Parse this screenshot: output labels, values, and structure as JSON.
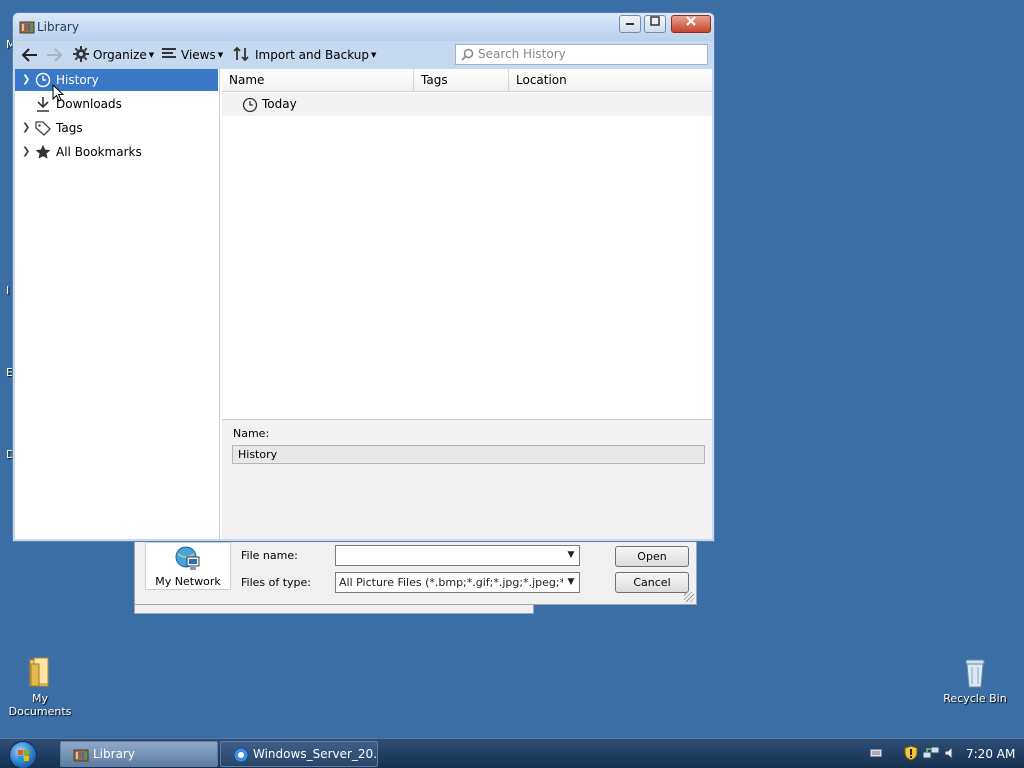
{
  "desktop": {
    "edge_letters": [
      "M",
      "I",
      "E",
      "D"
    ],
    "icons": [
      {
        "label": "My Documents",
        "icon": "folder-icon"
      },
      {
        "label": "Recycle Bin",
        "icon": "recycle-bin-icon"
      }
    ]
  },
  "open_dialog": {
    "places": {
      "my_network": "My Network"
    },
    "file_name_label": "File name:",
    "file_name_value": "",
    "files_of_type_label": "Files of type:",
    "files_of_type_value": "All Picture Files (*.bmp;*.gif;*.jpg;*.jpeg;*.dib;*.pr",
    "open_button": "Open",
    "cancel_button": "Cancel"
  },
  "library": {
    "title": "Library",
    "toolbar": {
      "back": "back-arrow-icon",
      "forward": "forward-arrow-icon",
      "organize": "Organize",
      "views": "Views",
      "import_backup": "Import and Backup",
      "search_placeholder": "Search History"
    },
    "sidebar": {
      "items": [
        {
          "label": "History",
          "icon": "clock-icon",
          "selected": true
        },
        {
          "label": "Downloads",
          "icon": "download-icon",
          "selected": false
        },
        {
          "label": "Tags",
          "icon": "tag-icon",
          "selected": false
        },
        {
          "label": "All Bookmarks",
          "icon": "star-icon",
          "selected": false
        }
      ]
    },
    "columns": [
      "Name",
      "Tags",
      "Location"
    ],
    "rows": [
      {
        "name": "Today",
        "icon": "clock-icon"
      }
    ],
    "details": {
      "name_label": "Name:",
      "name_value": "History"
    }
  },
  "taskbar": {
    "tasks": [
      {
        "label": "Library",
        "active": true
      },
      {
        "label": "Windows_Server_20...",
        "active": false
      }
    ],
    "clock": "7:20 AM"
  },
  "colors": {
    "desktop": "#3a6ea5",
    "selection": "#3a78c8",
    "taskbar": "#1d3a5f"
  }
}
